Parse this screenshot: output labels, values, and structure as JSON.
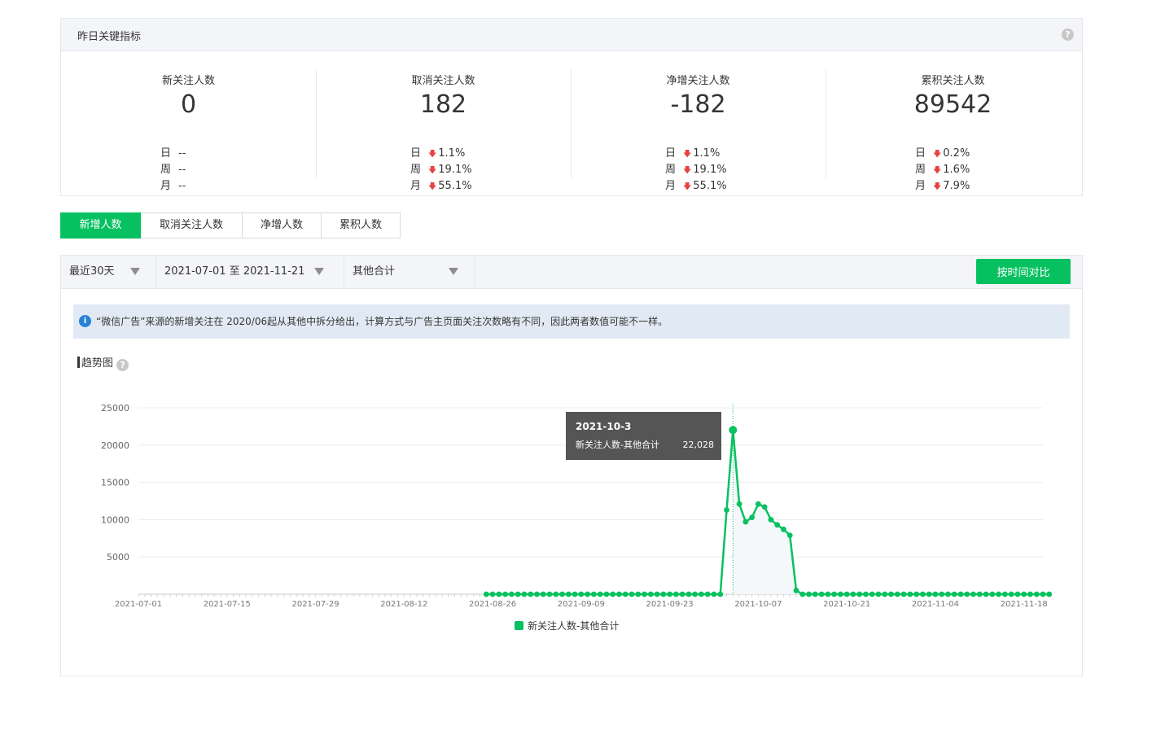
{
  "panel": {
    "title": "昨日关键指标",
    "help_icon": "question-icon",
    "metrics": [
      {
        "label": "新关注人数",
        "value": "0",
        "rows": [
          {
            "k": "日",
            "v": "--",
            "down": false
          },
          {
            "k": "周",
            "v": "--",
            "down": false
          },
          {
            "k": "月",
            "v": "--",
            "down": false
          }
        ]
      },
      {
        "label": "取消关注人数",
        "value": "182",
        "rows": [
          {
            "k": "日",
            "v": "1.1%",
            "down": true
          },
          {
            "k": "周",
            "v": "19.1%",
            "down": true
          },
          {
            "k": "月",
            "v": "55.1%",
            "down": true
          }
        ]
      },
      {
        "label": "净增关注人数",
        "value": "-182",
        "rows": [
          {
            "k": "日",
            "v": "1.1%",
            "down": true
          },
          {
            "k": "周",
            "v": "19.1%",
            "down": true
          },
          {
            "k": "月",
            "v": "55.1%",
            "down": true
          }
        ]
      },
      {
        "label": "累积关注人数",
        "value": "89542",
        "rows": [
          {
            "k": "日",
            "v": "0.2%",
            "down": true
          },
          {
            "k": "周",
            "v": "1.6%",
            "down": true
          },
          {
            "k": "月",
            "v": "7.9%",
            "down": true
          }
        ]
      }
    ]
  },
  "tabs": [
    {
      "label": "新增人数",
      "active": true
    },
    {
      "label": "取消关注人数",
      "active": false
    },
    {
      "label": "净增人数",
      "active": false
    },
    {
      "label": "累积人数",
      "active": false
    }
  ],
  "filters": {
    "range": "最近30天",
    "dates": "2021-07-01 至 2021-11-21",
    "source": "其他合计",
    "compare_button": "按时间对比"
  },
  "notice": "“微信广告”来源的新增关注在 2020/06起从其他中拆分给出，计算方式与广告主页面关注次数略有不同，因此两者数值可能不一样。",
  "trend": {
    "title": "趋势图"
  },
  "colors": {
    "accent": "#07c160",
    "down": "#e64340"
  },
  "chart_data": {
    "type": "line",
    "x_start": "2021-07-01",
    "x_end": "2021-11-21",
    "xtick_labels": [
      "2021-07-01",
      "2021-07-15",
      "2021-07-29",
      "2021-08-12",
      "2021-08-26",
      "2021-09-09",
      "2021-09-23",
      "2021-10-07",
      "2021-10-21",
      "2021-11-04",
      "2021-11-18"
    ],
    "ytick_labels": [
      "25000",
      "20000",
      "15000",
      "10000",
      "5000"
    ],
    "ylim": [
      0,
      25000
    ],
    "grid": true,
    "legend": "bottom",
    "series": [
      {
        "name": "新关注人数-其他合计",
        "color": "#07c160",
        "points_start": "2021-08-25",
        "values": [
          0,
          0,
          0,
          0,
          0,
          0,
          0,
          0,
          0,
          0,
          0,
          0,
          0,
          0,
          0,
          0,
          0,
          0,
          0,
          0,
          0,
          0,
          0,
          0,
          0,
          0,
          0,
          0,
          0,
          0,
          0,
          0,
          0,
          0,
          0,
          0,
          0,
          0,
          11300,
          22028,
          12100,
          9700,
          10300,
          12100,
          11700,
          10000,
          9300,
          8700,
          7900,
          500,
          0,
          0,
          0,
          0,
          0,
          0,
          0,
          0,
          0,
          0,
          0,
          0,
          0,
          0,
          0,
          0,
          0,
          0,
          0,
          0,
          0,
          0,
          0,
          0,
          0,
          0,
          0,
          0,
          0,
          0,
          0,
          0,
          0,
          0,
          0,
          0,
          0,
          0,
          0,
          0
        ]
      }
    ],
    "tooltip": {
      "date": "2021-10-3",
      "series": "新关注人数-其他合计",
      "value": "22,028"
    }
  }
}
